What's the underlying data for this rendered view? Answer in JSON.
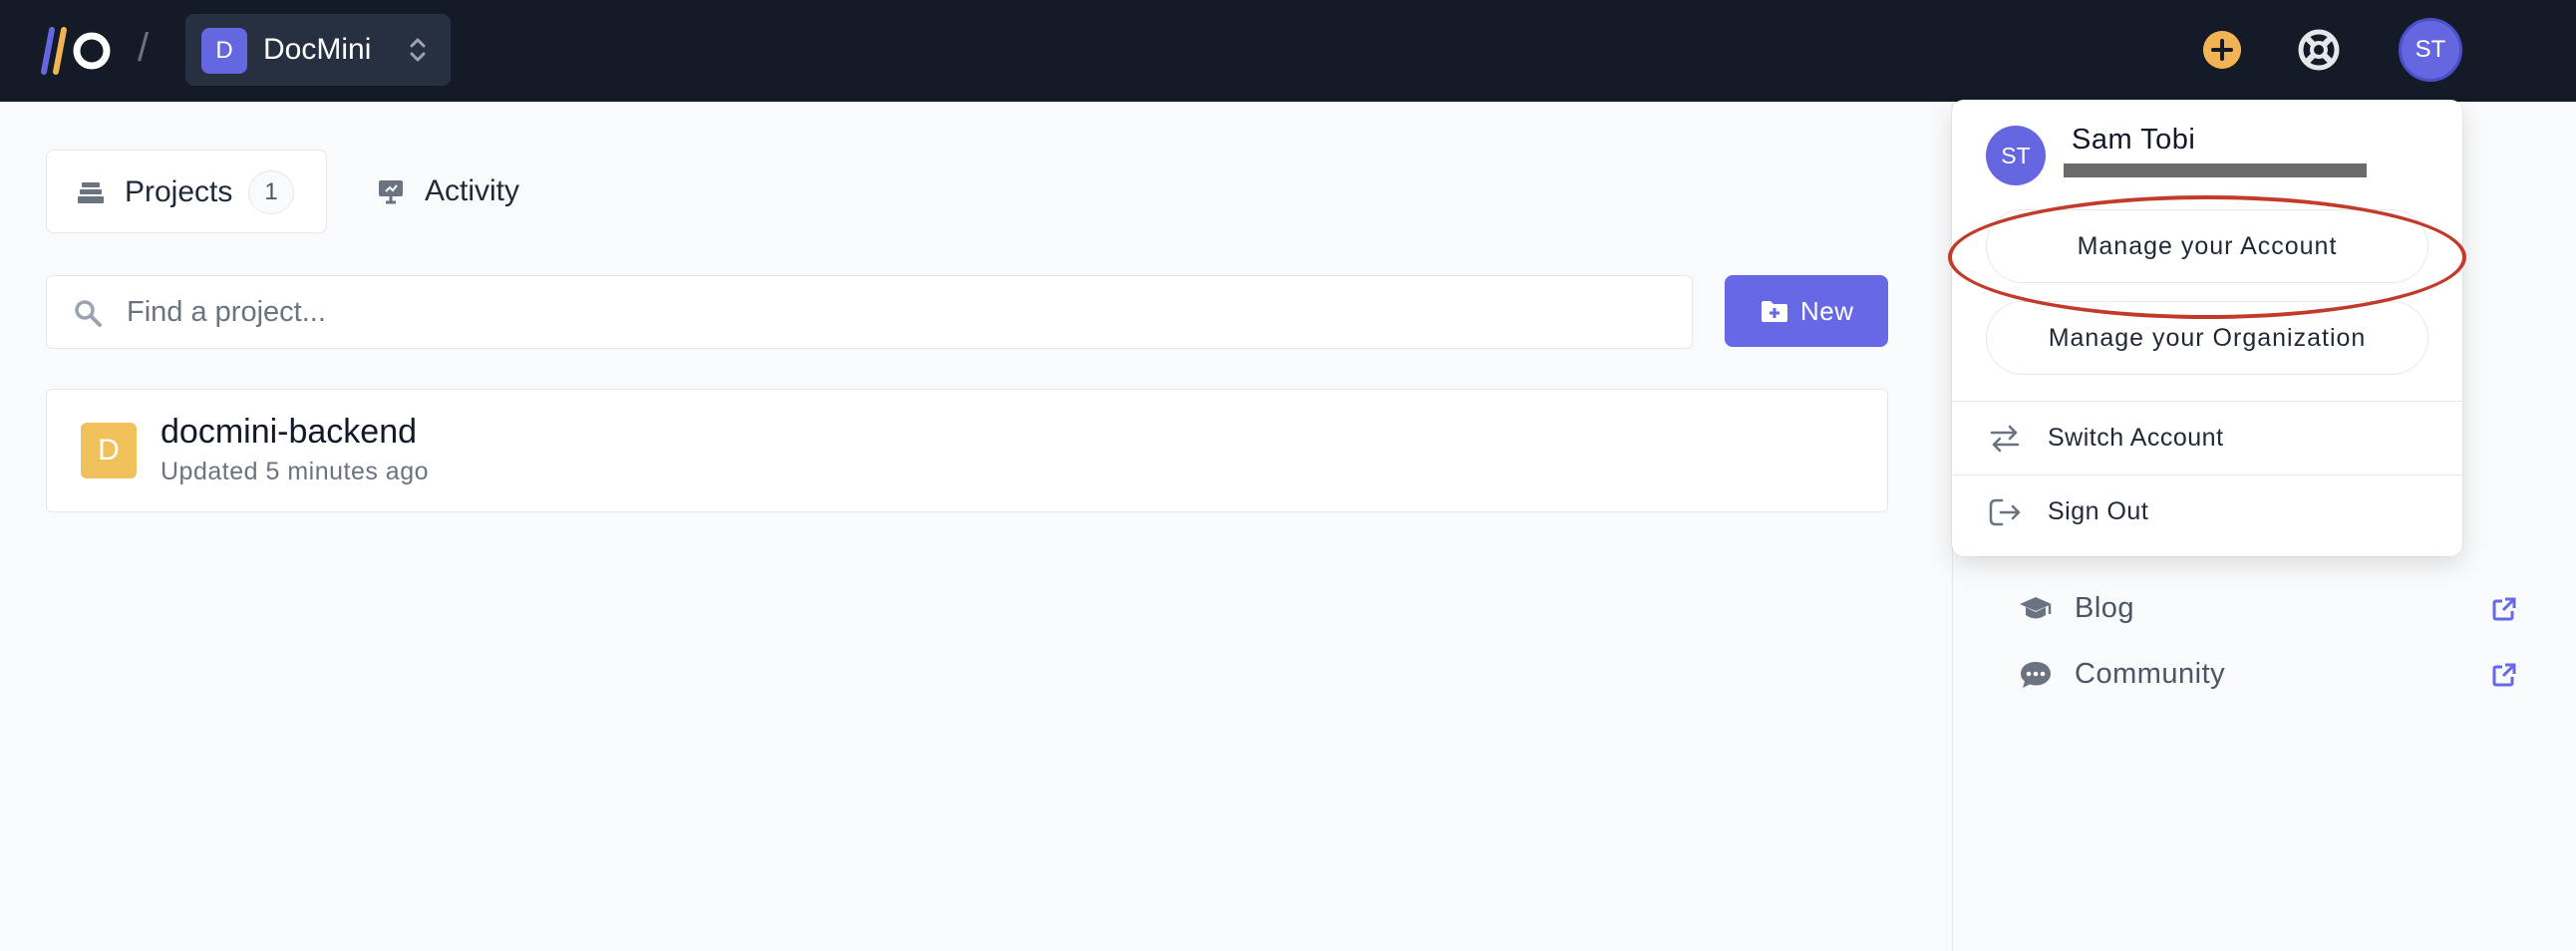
{
  "topbar": {
    "separator": "/",
    "org": {
      "initial": "D",
      "name": "DocMini"
    },
    "user_initials": "ST"
  },
  "tabs": [
    {
      "label": "Projects",
      "count": "1",
      "icon": "stack-icon"
    },
    {
      "label": "Activity",
      "icon": "presentation-icon"
    }
  ],
  "search": {
    "placeholder": "Find a project..."
  },
  "new_button": {
    "label": "New",
    "icon": "folder-plus-icon"
  },
  "projects": [
    {
      "initial": "D",
      "name": "docmini-backend",
      "updated": "Updated 5 minutes ago"
    }
  ],
  "sidebar": {
    "links": [
      {
        "label": "Blog",
        "icon": "graduation-cap-icon"
      },
      {
        "label": "Community",
        "icon": "chat-bubble-icon"
      }
    ]
  },
  "account_menu": {
    "initials": "ST",
    "name": "Sam Tobi",
    "manage_account": "Manage your Account",
    "manage_org": "Manage your Organization",
    "switch_account": "Switch Account",
    "sign_out": "Sign Out"
  },
  "colors": {
    "topbar_bg": "#141a26",
    "accent": "#6668e6",
    "project_avatar": "#f0c05a",
    "highlight": "#c23b2a"
  }
}
